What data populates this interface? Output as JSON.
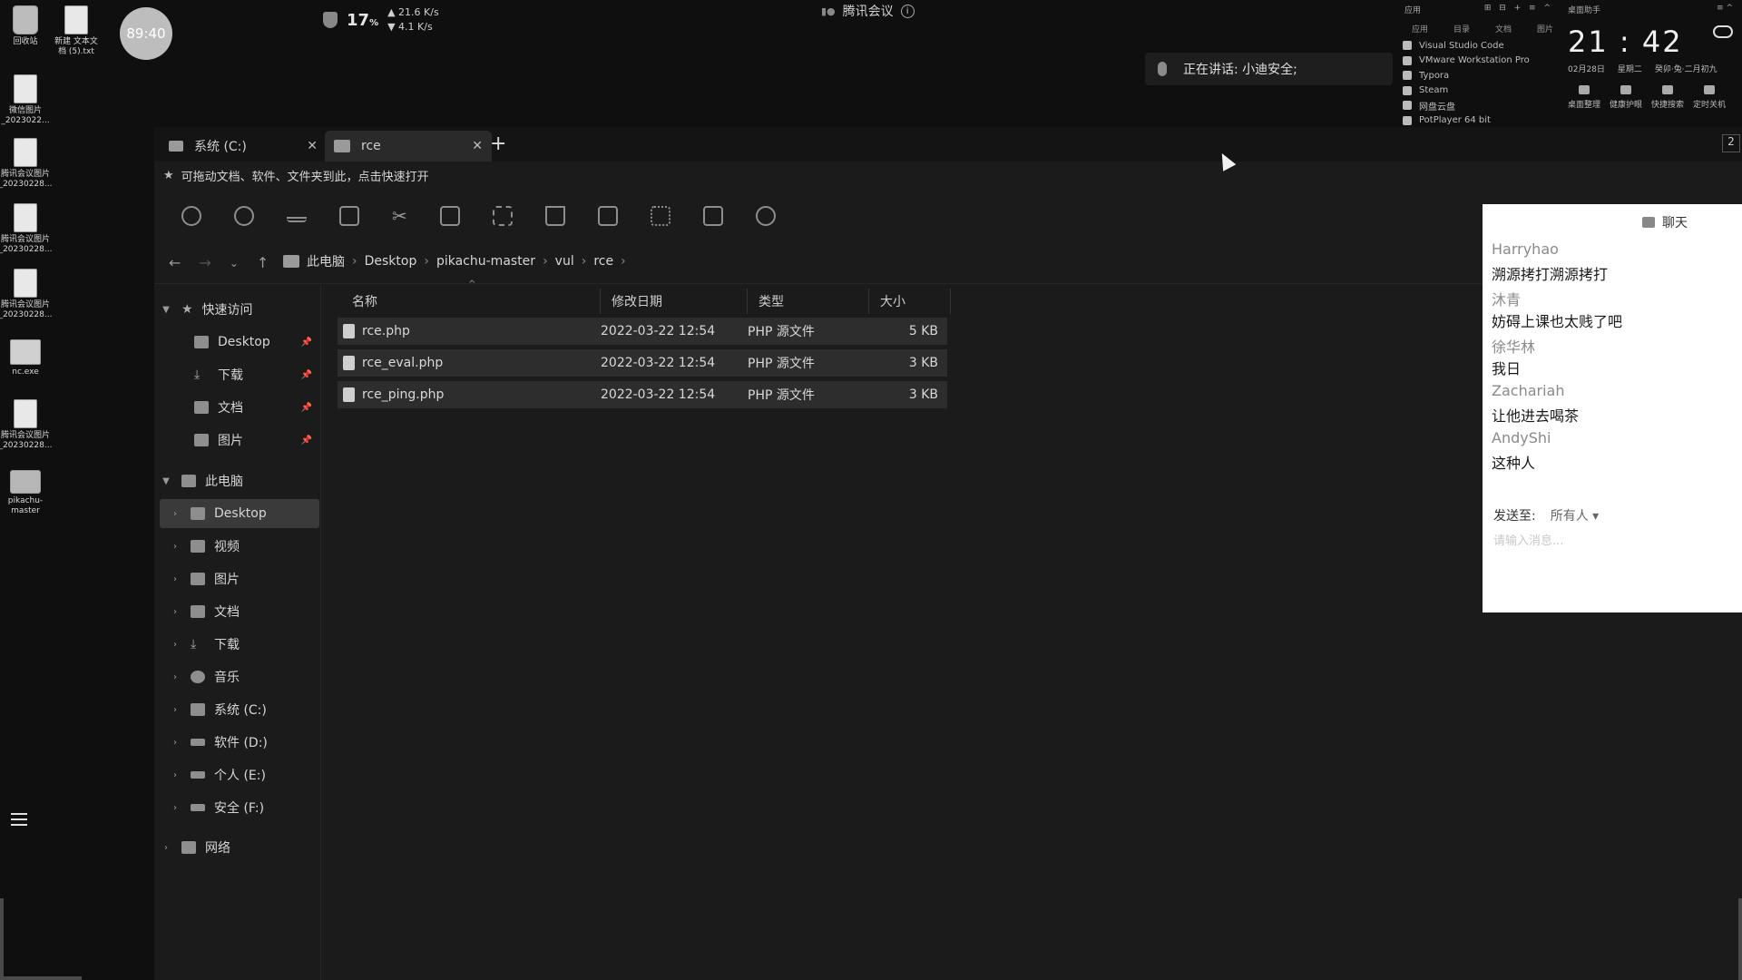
{
  "desktop": {
    "icons": [
      {
        "label": "回收站"
      },
      {
        "label": "新建 文本文档 (5).txt"
      },
      {
        "label": "微信图片_2023022..."
      },
      {
        "label": "腾讯会议图片_20230228..."
      },
      {
        "label": "腾讯会议图片_20230228..."
      },
      {
        "label": "腾讯会议图片_20230228..."
      },
      {
        "label": "nc.exe"
      },
      {
        "label": "腾讯会议图片_20230228..."
      },
      {
        "label": "pikachu-master"
      }
    ],
    "timer": "89:40"
  },
  "status": {
    "cpu": "17",
    "cpu_unit": "%",
    "up": "▲ 21.6 K/s",
    "down": "▼ 4.1 K/s",
    "meeting_title": "腾讯会议",
    "speaking": "正在讲话: 小迪安全;"
  },
  "widget": {
    "apps_header": "应用",
    "apps_tabs": [
      "应用",
      "目录",
      "文档",
      "图片"
    ],
    "apps": [
      "Visual Studio Code",
      "VMware Workstation Pro",
      "Typora",
      "Steam",
      "网盘云盘",
      "PotPlayer 64 bit"
    ],
    "assistant_title": "桌面助手",
    "time": "21 : 42",
    "date": "02月28日",
    "weekday": "星期二",
    "lunar": "癸卯·兔·二月初九",
    "tools": [
      "桌面整理",
      "健康护眼",
      "快捷搜索",
      "定时关机"
    ]
  },
  "explorer": {
    "tabs": [
      {
        "label": "系统 (C:)"
      },
      {
        "label": "rce"
      }
    ],
    "fav_hint": "可拖动文档、软件、文件夹到此，点击快速打开",
    "breadcrumbs": [
      "此电脑",
      "Desktop",
      "pikachu-master",
      "vul",
      "rce"
    ],
    "columns": {
      "name": "名称",
      "date": "修改日期",
      "type": "类型",
      "size": "大小"
    },
    "files": [
      {
        "name": "rce.php",
        "date": "2022-03-22 12:54",
        "type": "PHP 源文件",
        "size": "5 KB"
      },
      {
        "name": "rce_eval.php",
        "date": "2022-03-22 12:54",
        "type": "PHP 源文件",
        "size": "3 KB"
      },
      {
        "name": "rce_ping.php",
        "date": "2022-03-22 12:54",
        "type": "PHP 源文件",
        "size": "3 KB"
      }
    ],
    "sidebar": {
      "quick_access": "快速访问",
      "quick_items": [
        "Desktop",
        "下载",
        "文档",
        "图片"
      ],
      "this_pc": "此电脑",
      "pc_items": [
        "Desktop",
        "视频",
        "图片",
        "文档",
        "下载",
        "音乐",
        "系统 (C:)",
        "软件 (D:)",
        "个人 (E:)",
        "安全 (F:)"
      ],
      "network": "网络"
    }
  },
  "chat": {
    "title": "聊天",
    "messages": [
      {
        "name": "Harryhao",
        "text": "溯源拷打溯源拷打"
      },
      {
        "name": "沐青",
        "text": "妨碍上课也太贱了吧"
      },
      {
        "name": "徐华林",
        "text": "我日"
      },
      {
        "name": "Zachariah",
        "text": "让他进去喝茶"
      },
      {
        "name": "AndyShi",
        "text": "这种人"
      }
    ],
    "send_to_label": "发送至:",
    "send_to_value": "所有人 ▾",
    "input_placeholder": "请输入消息..."
  },
  "page_indicator": "2"
}
